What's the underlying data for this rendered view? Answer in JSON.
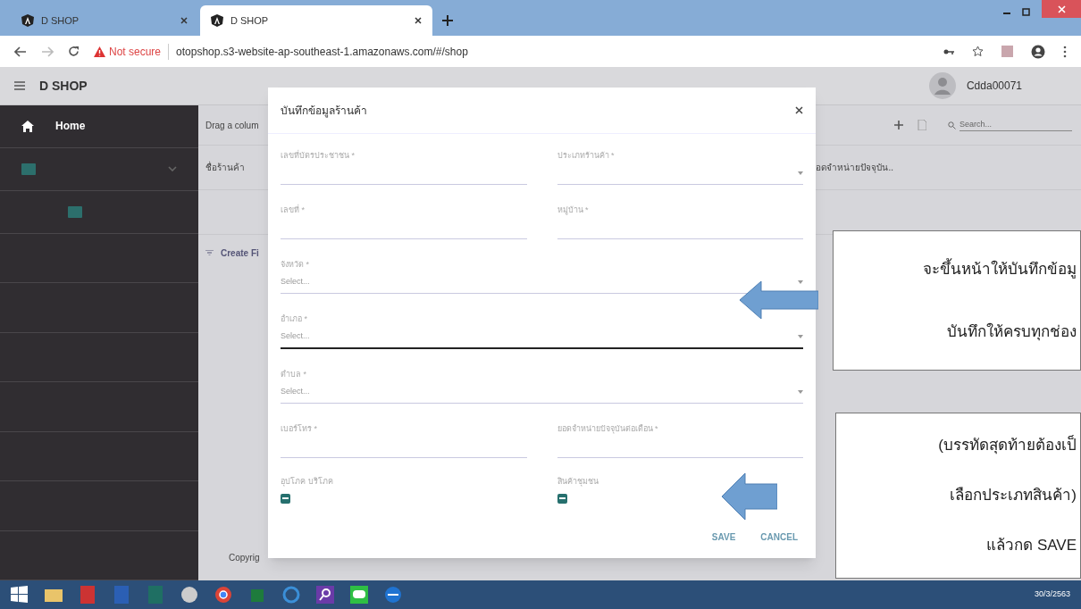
{
  "browser": {
    "tabs": [
      {
        "title": "D SHOP",
        "selected": false
      },
      {
        "title": "D SHOP",
        "selected": true
      }
    ],
    "security": "Not secure",
    "url": "otopshop.s3-website-ap-southeast-1.amazonaws.com/#/shop"
  },
  "app": {
    "title": "D SHOP",
    "user": "Cdda00071"
  },
  "sidebar": {
    "items": [
      {
        "kind": "home",
        "label": "Home"
      },
      {
        "kind": "folder",
        "expanded": true,
        "children": [
          {
            "kind": "folder"
          }
        ]
      }
    ]
  },
  "grid": {
    "group_hint": "Drag a colum",
    "columns": [
      "ชื่อร้านค้า",
      "อดจำหน่ายปัจจุบัน.."
    ],
    "search_placeholder": "Search...",
    "filter": "Create Fi",
    "footer": "Copyrig"
  },
  "dialog": {
    "title": "บันทึกข้อมูลร้านค้า",
    "rows": [
      [
        {
          "label": "เลขที่บัตรประชาชน *",
          "kind": "text",
          "focused": false
        },
        {
          "label": "ประเภทร้านค้า *",
          "kind": "select",
          "focused": false
        }
      ],
      [
        {
          "label": "เลขที่ *",
          "kind": "text",
          "focused": false
        },
        {
          "label": "หมู่บ้าน *",
          "kind": "text",
          "focused": false
        }
      ],
      [
        {
          "label": "จังหวัด *",
          "kind": "select",
          "placeholder": "Select...",
          "focused": false
        }
      ],
      [
        {
          "label": "อำเภอ *",
          "kind": "select",
          "placeholder": "Select...",
          "focused": true
        }
      ],
      [
        {
          "label": "ตำบล *",
          "kind": "select",
          "placeholder": "Select...",
          "focused": false
        }
      ],
      [
        {
          "label": "เบอร์โทร *",
          "kind": "text",
          "focused": false
        },
        {
          "label": "ยอดจำหน่ายปัจจุบันต่อเดือน *",
          "kind": "text",
          "focused": false
        }
      ]
    ],
    "checkboxes": [
      {
        "label": "อุปโภค บริโภค",
        "indeterminate": true
      },
      {
        "label": "สินค้าชุมชน",
        "indeterminate": true
      }
    ],
    "buttons": [
      "SAVE",
      "CANCEL"
    ]
  },
  "callouts": [
    {
      "lines": [
        "จะขึ้นหน้าให้บันทึกข้อมู",
        "บันทึกให้ครบทุกช่อง"
      ]
    },
    {
      "lines": [
        "(บรรทัดสุดท้ายต้องเป็",
        "เลือกประเภทสินค้า)",
        "แล้วกด SAVE"
      ]
    }
  ],
  "taskbar": {
    "clock": "30/3/2563"
  }
}
